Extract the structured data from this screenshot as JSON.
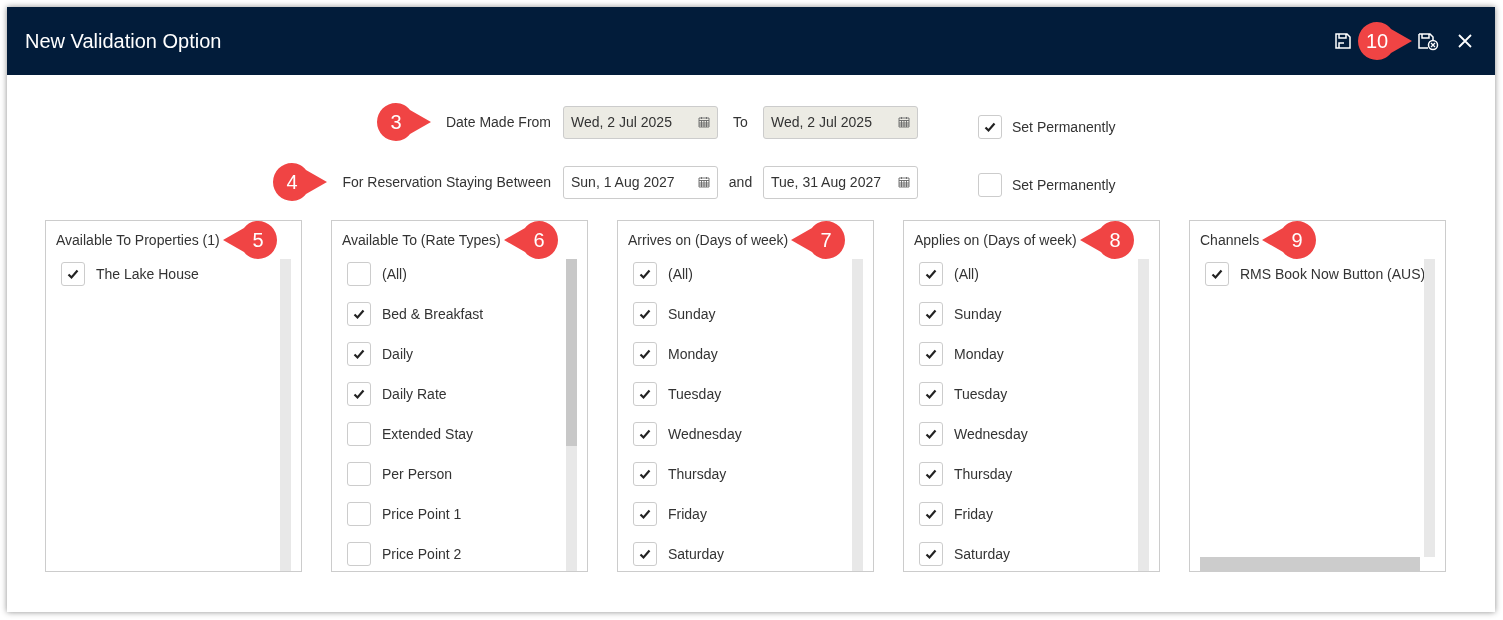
{
  "window": {
    "title": "New Validation Option",
    "callout": {
      "label": "10"
    }
  },
  "date_rows": [
    {
      "callout": {
        "label": "3"
      },
      "label": "Date Made From",
      "from": "Wed, 2 Jul 2025",
      "connector": "To",
      "to": "Wed, 2 Jul 2025",
      "disabled": true,
      "set_permanently": {
        "label": "Set Permanently",
        "checked": true
      }
    },
    {
      "callout": {
        "label": "4"
      },
      "label": "For Reservation Staying Between",
      "from": "Sun, 1 Aug 2027",
      "connector": "and",
      "to": "Tue, 31 Aug 2027",
      "disabled": false,
      "set_permanently": {
        "label": "Set Permanently",
        "checked": false
      }
    }
  ],
  "panels": [
    {
      "title": "Available To Properties (1)",
      "callout": {
        "label": "5"
      },
      "items": [
        {
          "label": "The Lake House",
          "checked": true
        }
      ]
    },
    {
      "title": "Available To (Rate Types)",
      "callout": {
        "label": "6"
      },
      "items": [
        {
          "label": "(All)",
          "checked": false
        },
        {
          "label": "Bed & Breakfast",
          "checked": true
        },
        {
          "label": "Daily",
          "checked": true
        },
        {
          "label": "Daily Rate",
          "checked": true
        },
        {
          "label": "Extended Stay",
          "checked": false
        },
        {
          "label": "Per Person",
          "checked": false
        },
        {
          "label": "Price Point 1",
          "checked": false
        },
        {
          "label": "Price Point 2",
          "checked": false
        }
      ]
    },
    {
      "title": "Arrives on (Days of week)",
      "callout": {
        "label": "7"
      },
      "items": [
        {
          "label": "(All)",
          "checked": true
        },
        {
          "label": "Sunday",
          "checked": true
        },
        {
          "label": "Monday",
          "checked": true
        },
        {
          "label": "Tuesday",
          "checked": true
        },
        {
          "label": "Wednesday",
          "checked": true
        },
        {
          "label": "Thursday",
          "checked": true
        },
        {
          "label": "Friday",
          "checked": true
        },
        {
          "label": "Saturday",
          "checked": true
        }
      ]
    },
    {
      "title": "Applies on (Days of week)",
      "callout": {
        "label": "8"
      },
      "items": [
        {
          "label": "(All)",
          "checked": true
        },
        {
          "label": "Sunday",
          "checked": true
        },
        {
          "label": "Monday",
          "checked": true
        },
        {
          "label": "Tuesday",
          "checked": true
        },
        {
          "label": "Wednesday",
          "checked": true
        },
        {
          "label": "Thursday",
          "checked": true
        },
        {
          "label": "Friday",
          "checked": true
        },
        {
          "label": "Saturday",
          "checked": true
        }
      ]
    },
    {
      "title": "Channels",
      "callout": {
        "label": "9"
      },
      "items": [
        {
          "label": "RMS Book Now Button (AUS)",
          "checked": true
        }
      ]
    }
  ]
}
